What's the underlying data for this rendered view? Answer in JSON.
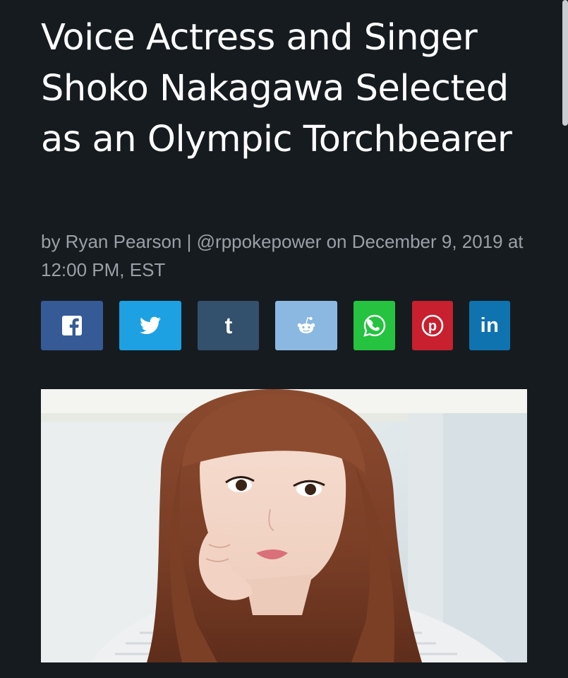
{
  "article": {
    "title": "Voice Actress and Singer Shoko Nakagawa Selected as an Olympic Torchbearer",
    "byline": "by Ryan Pearson | @rppokepower on December 9, 2019 at 12:00 PM, EST"
  },
  "share_buttons": [
    {
      "network": "Facebook",
      "icon": "facebook-icon",
      "color": "#365a96"
    },
    {
      "network": "Twitter",
      "icon": "twitter-icon",
      "color": "#1da1e2"
    },
    {
      "network": "Tumblr",
      "icon": "tumblr-icon",
      "color": "#33506d"
    },
    {
      "network": "Reddit",
      "icon": "reddit-icon",
      "color": "#8bb8e0"
    },
    {
      "network": "WhatsApp",
      "icon": "whatsapp-icon",
      "color": "#25c340"
    },
    {
      "network": "Pinterest",
      "icon": "pinterest-icon",
      "color": "#c8202e"
    },
    {
      "network": "LinkedIn",
      "icon": "linkedin-icon",
      "label": "in",
      "color": "#0f73b0"
    }
  ],
  "hero_image": {
    "subject": "portrait-photo"
  }
}
